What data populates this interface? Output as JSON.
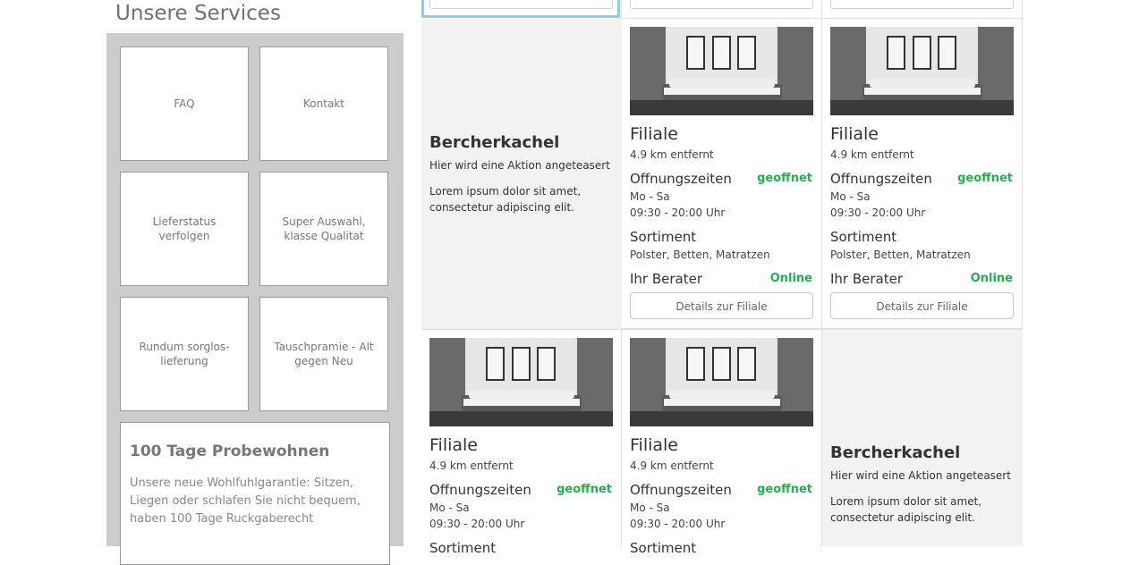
{
  "services": {
    "title": "Unsere Services",
    "tiles": [
      {
        "label": "FAQ"
      },
      {
        "label": "Kontakt"
      },
      {
        "label": "Lieferstatus verfolgen"
      },
      {
        "label": "Super Auswahl, klasse Qualitat"
      },
      {
        "label": "Rundum sorglos-lieferung"
      },
      {
        "label": "Tauschpramie - Alt gegen Neu"
      }
    ],
    "promo": {
      "title": "100 Tage Probewohnen",
      "text": "Unsere neue Wohlfuhlgarantie: Sitzen, Liegen oder schlafen Sie nicht bequem, haben 100 Tage Ruckgaberecht"
    }
  },
  "filiale": {
    "title": "Filiale",
    "distance": "4.9 km entfernt",
    "hours_label": "Offnungszeiten",
    "status": "geoffnet",
    "days": "Mo - Sa",
    "time": "09:30 - 20:00 Uhr",
    "assortment_label": "Sortiment",
    "assortment": "Polster, Betten, Matratzen",
    "advisor_label": "Ihr Berater",
    "advisor_status": "Online",
    "button": "Details zur Filiale"
  },
  "teaser": {
    "title": "Bercherkachel",
    "subtitle": "Hier wird eine Aktion angeteasert",
    "text": "Lorem ipsum dolor sit amet, consectetur adipiscing elit."
  },
  "colors": {
    "accent_green": "#22b14c",
    "focus_blue": "#8fcbe8"
  }
}
